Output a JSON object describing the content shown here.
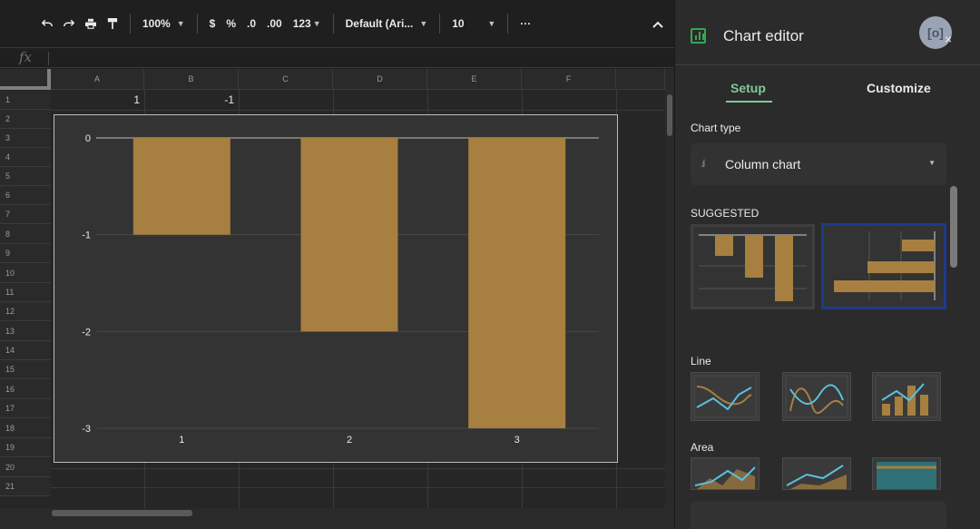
{
  "toolbar": {
    "zoom": "100%",
    "currency": "$",
    "percent": "%",
    "decrease_decimals": ".0",
    "increase_decimals": ".00",
    "more_formats": "123",
    "font": "Default (Ari...",
    "font_size": "10",
    "more": "···",
    "icons": [
      "undo-icon",
      "redo-icon",
      "print-icon",
      "paint-format-icon",
      "collapse-icon"
    ]
  },
  "formula_bar": {
    "fx": "fx"
  },
  "sheet": {
    "columns": [
      "A",
      "B",
      "C",
      "D",
      "E",
      "F"
    ],
    "rows": [
      "1",
      "2",
      "3",
      "4",
      "5",
      "6",
      "7",
      "8",
      "9",
      "10",
      "11",
      "12",
      "13",
      "14",
      "15",
      "16",
      "17",
      "18",
      "19",
      "20",
      "21"
    ],
    "cells": {
      "A1": "1",
      "B1": "-1"
    }
  },
  "chart_data": {
    "type": "bar",
    "categories": [
      "1",
      "2",
      "3"
    ],
    "values": [
      -1,
      -2,
      -3
    ],
    "ylim": [
      -3,
      0
    ],
    "yticks": [
      "0",
      "-1",
      "-2",
      "-3"
    ],
    "grid": true,
    "bar_color": "#a67f41",
    "background_color": "#333333"
  },
  "panel": {
    "title": "Chart editor",
    "tabs": {
      "setup": "Setup",
      "customize": "Customize"
    },
    "chart_type_label": "Chart type",
    "chart_type_value": "Column chart",
    "suggested_label": "SUGGESTED",
    "line_label": "Line",
    "area_label": "Area",
    "accent_color": "#81c995",
    "selected_border_color": "#1e3a8a"
  }
}
